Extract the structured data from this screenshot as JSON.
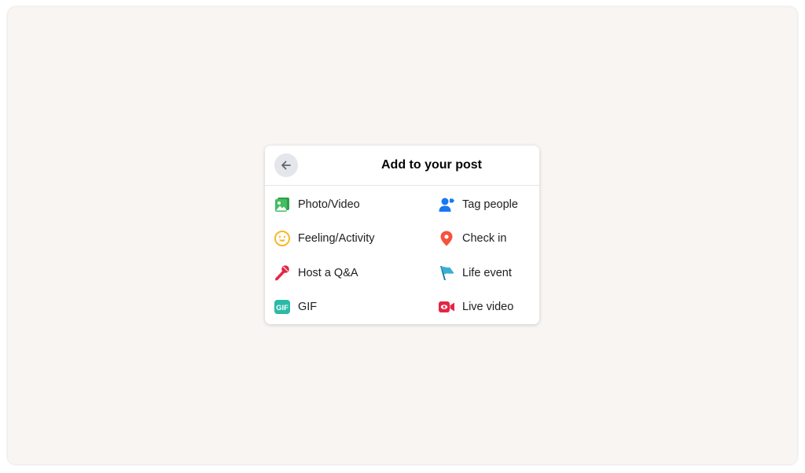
{
  "dialog": {
    "title": "Add to your post",
    "back_icon": "arrow-left-icon"
  },
  "options": [
    {
      "label": "Photo/Video",
      "icon": "photo-video-icon",
      "color": "#45bd62"
    },
    {
      "label": "Tag people",
      "icon": "tag-people-icon",
      "color": "#1877f2"
    },
    {
      "label": "Feeling/Activity",
      "icon": "feeling-icon",
      "color": "#f7b928"
    },
    {
      "label": "Check in",
      "icon": "location-pin-icon",
      "color": "#f5533d"
    },
    {
      "label": "Host a Q&A",
      "icon": "microphone-icon",
      "color": "#e42645"
    },
    {
      "label": "Life event",
      "icon": "flag-icon",
      "color": "#39afd5"
    },
    {
      "label": "GIF",
      "icon": "gif-icon",
      "color": "#2abba7"
    },
    {
      "label": "Live video",
      "icon": "live-video-icon",
      "color": "#e42645"
    }
  ]
}
